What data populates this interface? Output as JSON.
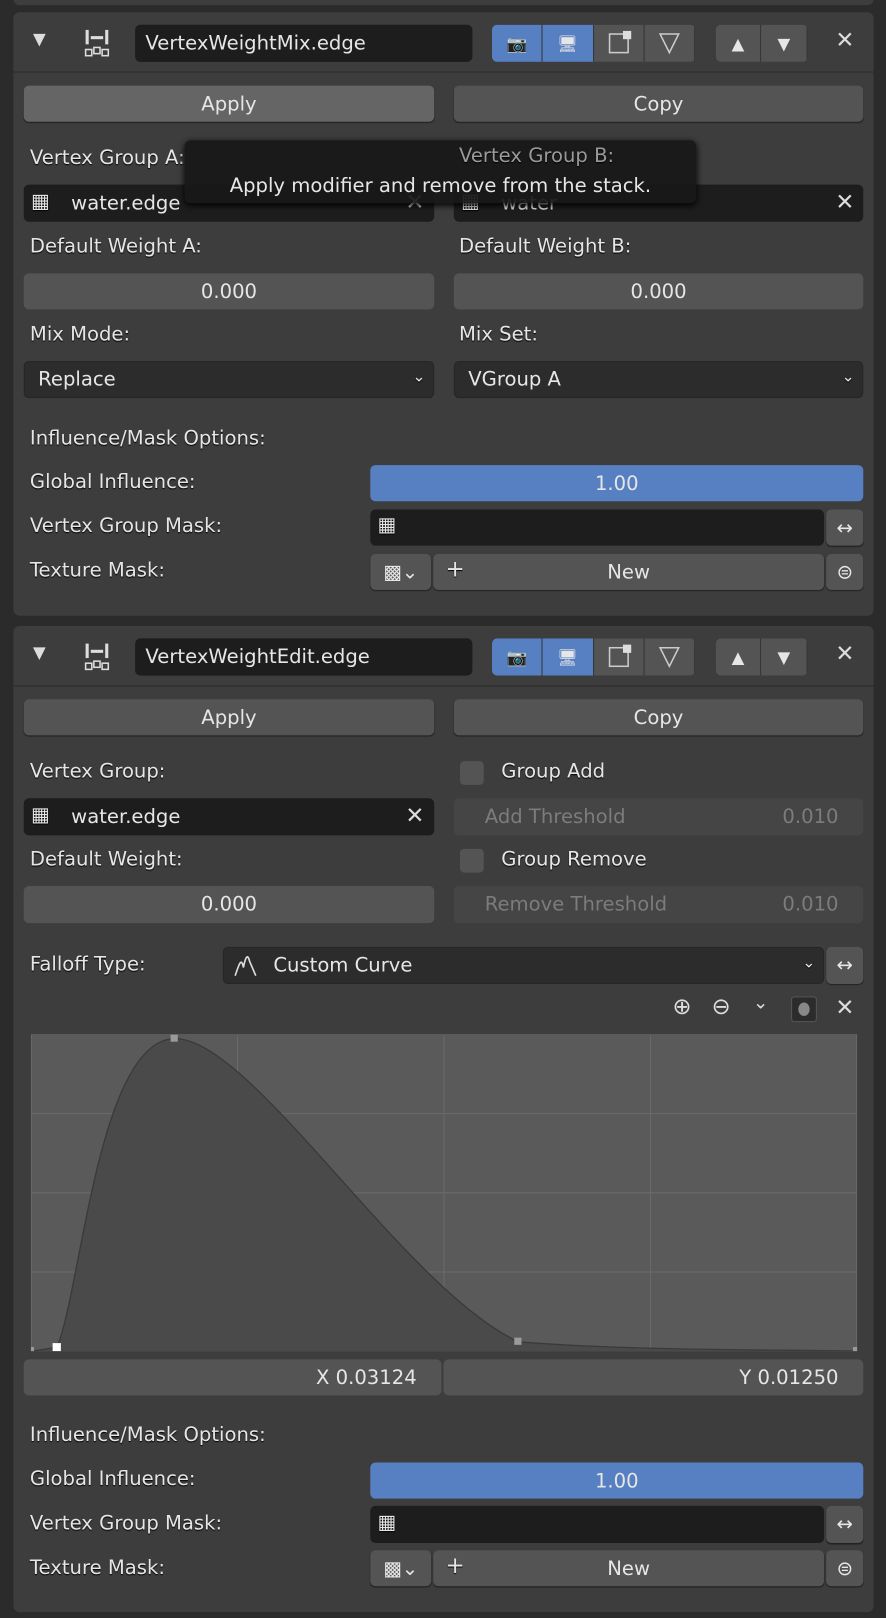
{
  "tooltip": "Apply modifier and remove from the stack.",
  "mix": {
    "name": "VertexWeightMix.edge",
    "apply": "Apply",
    "copy": "Copy",
    "vgroup_a_label": "Vertex Group A:",
    "vgroup_b_label": "Vertex Group B:",
    "vgroup_a": "water.edge",
    "vgroup_b": "water",
    "default_a_label": "Default Weight A:",
    "default_b_label": "Default Weight B:",
    "default_a": "0.000",
    "default_b": "0.000",
    "mix_mode_label": "Mix Mode:",
    "mix_mode": "Replace",
    "mix_set_label": "Mix Set:",
    "mix_set": "VGroup A",
    "influence_label": "Influence/Mask Options:",
    "global_influence_label": "Global Influence:",
    "global_influence": "1.00",
    "vgroup_mask_label": "Vertex Group Mask:",
    "vgroup_mask": "",
    "texture_mask_label": "Texture Mask:",
    "new_label": "New"
  },
  "edit": {
    "name": "VertexWeightEdit.edge",
    "apply": "Apply",
    "copy": "Copy",
    "vgroup_label": "Vertex Group:",
    "vgroup": "water.edge",
    "group_add_label": "Group Add",
    "group_add": false,
    "add_threshold_label": "Add Threshold",
    "add_threshold": "0.010",
    "default_label": "Default Weight:",
    "default": "0.000",
    "group_remove_label": "Group Remove",
    "group_remove": false,
    "remove_threshold_label": "Remove Threshold",
    "remove_threshold": "0.010",
    "falloff_label": "Falloff Type:",
    "falloff": "Custom Curve",
    "curve_x": "X 0.03124",
    "curve_y": "Y 0.01250",
    "influence_label": "Influence/Mask Options:",
    "global_influence_label": "Global Influence:",
    "global_influence": "1.00",
    "vgroup_mask_label": "Vertex Group Mask:",
    "vgroup_mask": "",
    "texture_mask_label": "Texture Mask:",
    "new_label": "New",
    "curve_points": [
      [
        0,
        0
      ],
      [
        0.03124,
        0.0125
      ],
      [
        0.174,
        1.0
      ],
      [
        0.59,
        0.03
      ],
      [
        1,
        0
      ]
    ],
    "selected_point": 1
  },
  "colors": {
    "accent": "#5680c2",
    "panel": "#3d3d3d",
    "field": "#1d1d1d"
  }
}
